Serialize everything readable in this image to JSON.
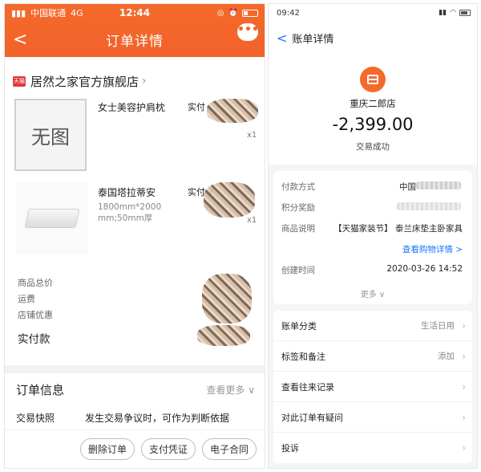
{
  "left": {
    "status": {
      "carrier": "中国联通",
      "network": "4G",
      "time": "12:44"
    },
    "nav": {
      "back": "<",
      "title": "订单详情",
      "more": "•••"
    },
    "store": {
      "badge": "天猫",
      "name": "居然之家官方旗舰店",
      "chevron": "›"
    },
    "products": [
      {
        "thumb_text": "无图",
        "name": "女士美容护肩枕",
        "paid_label": "实付",
        "qty": "x1"
      },
      {
        "name": "泰国塔拉蒂安",
        "spec": "1800mm*2000 mm;50mm厚",
        "paid_label": "实付 ¥",
        "qty": "x1"
      }
    ],
    "fees": [
      "商品总价",
      "运费",
      "店铺优惠"
    ],
    "paid_total_label": "实付款",
    "order_info": {
      "title": "订单信息",
      "more": "查看更多 ∨"
    },
    "snapshot": {
      "key": "交易快照",
      "value": "发生交易争议时，可作为判断依据"
    },
    "buttons": [
      "删除订单",
      "支付凭证",
      "电子合同"
    ]
  },
  "right": {
    "status": {
      "time": "09:42"
    },
    "nav": {
      "back": "<",
      "title": "账单详情"
    },
    "merchant": "重庆二郎店",
    "amount": "-2,399.00",
    "status_text": "交易成功",
    "details": [
      {
        "key": "付款方式",
        "value": "中国"
      },
      {
        "key": "积分奖励",
        "value": ""
      },
      {
        "key": "商品说明",
        "value": "【天猫家装节】 泰兰床垫主卧家具"
      },
      {
        "key": "",
        "value": "查看购物详情 >"
      },
      {
        "key": "创建时间",
        "value": "2020-03-26 14:52"
      }
    ],
    "more": "更多 ∨",
    "rows": [
      {
        "label": "账单分类",
        "value": "生活日用"
      },
      {
        "label": "标签和备注",
        "value": "添加"
      },
      {
        "label": "查看往来记录",
        "value": ""
      },
      {
        "label": "对此订单有疑问",
        "value": ""
      },
      {
        "label": "投诉",
        "value": ""
      }
    ],
    "chevron": "›"
  }
}
